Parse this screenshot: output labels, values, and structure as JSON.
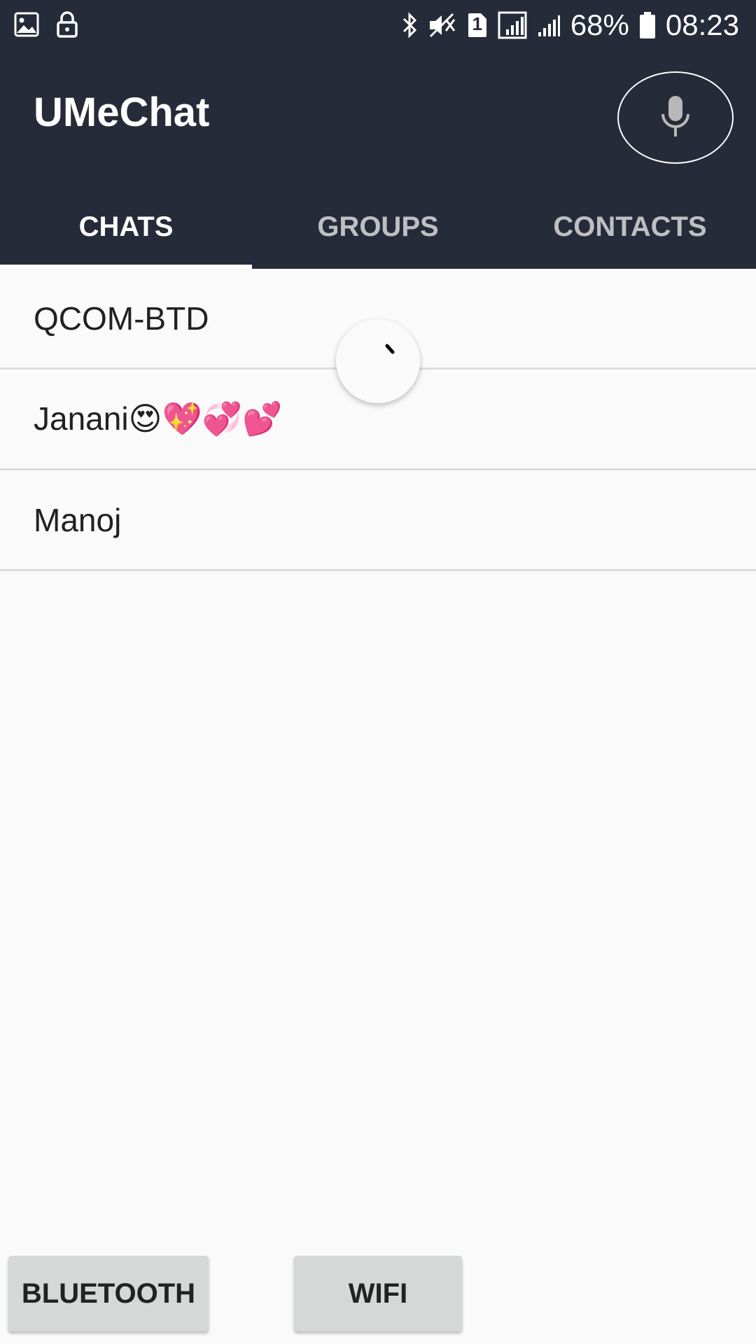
{
  "status_bar": {
    "battery_percent": "68%",
    "time": "08:23",
    "sim_label": "1",
    "icons_left": [
      "image-icon",
      "lock-icon"
    ],
    "icons_right": [
      "bluetooth-icon",
      "mute-icon",
      "sim-icon",
      "signal-icon",
      "signal-icon",
      "battery-icon"
    ]
  },
  "app_bar": {
    "title": "UMeChat",
    "mic_icon": "mic-icon"
  },
  "tabs": [
    {
      "label": "CHATS",
      "active": true
    },
    {
      "label": "GROUPS",
      "active": false
    },
    {
      "label": "CONTACTS",
      "active": false
    }
  ],
  "chats": [
    {
      "name": "QCOM-BTD"
    },
    {
      "name": "Janani😍💖💞💕"
    },
    {
      "name": "Manoj"
    }
  ],
  "buttons": {
    "bluetooth": "BLUETOOTH",
    "wifi": "WIFI"
  },
  "colors": {
    "header_bg": "#252b38",
    "page_bg": "#fafafa",
    "button_bg": "#d6d7d7"
  }
}
